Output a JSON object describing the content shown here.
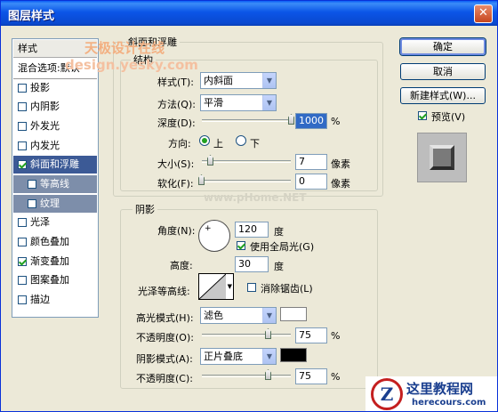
{
  "window": {
    "title": "图层样式",
    "close_glyph": "✕"
  },
  "left_list": {
    "items": [
      {
        "label": "样式",
        "checkbox": false,
        "state": "header"
      },
      {
        "label": "混合选项:默认",
        "checkbox": false,
        "state": "normal"
      },
      {
        "label": "投影",
        "checkbox": true,
        "checked": false,
        "state": "normal"
      },
      {
        "label": "内阴影",
        "checkbox": true,
        "checked": false,
        "state": "normal"
      },
      {
        "label": "外发光",
        "checkbox": true,
        "checked": false,
        "state": "normal"
      },
      {
        "label": "内发光",
        "checkbox": true,
        "checked": false,
        "state": "normal"
      },
      {
        "label": "斜面和浮雕",
        "checkbox": true,
        "checked": true,
        "state": "selected"
      },
      {
        "label": "等高线",
        "checkbox": true,
        "checked": false,
        "state": "sub"
      },
      {
        "label": "纹理",
        "checkbox": true,
        "checked": false,
        "state": "sub"
      },
      {
        "label": "光泽",
        "checkbox": true,
        "checked": false,
        "state": "normal"
      },
      {
        "label": "颜色叠加",
        "checkbox": true,
        "checked": false,
        "state": "normal"
      },
      {
        "label": "渐变叠加",
        "checkbox": true,
        "checked": true,
        "state": "normal"
      },
      {
        "label": "图案叠加",
        "checkbox": true,
        "checked": false,
        "state": "normal"
      },
      {
        "label": "描边",
        "checkbox": true,
        "checked": false,
        "state": "normal"
      }
    ]
  },
  "bevel": {
    "group_title": "斜面和浮雕",
    "structure_title": "结构",
    "style_label": "样式(T):",
    "style_value": "内斜面",
    "technique_label": "方法(Q):",
    "technique_value": "平滑",
    "depth_label": "深度(D):",
    "depth_value": "1000",
    "depth_unit": "%",
    "depth_level": 1.0,
    "direction_label": "方向:",
    "direction_up": "上",
    "direction_down": "下",
    "direction_selected": "上",
    "size_label": "大小(S):",
    "size_value": "7",
    "size_unit": "像素",
    "size_level": 0.05,
    "soften_label": "软化(F):",
    "soften_value": "0",
    "soften_unit": "像素",
    "soften_level": 0.0
  },
  "shading": {
    "group_title": "阴影",
    "angle_label": "角度(N):",
    "angle_value": "120",
    "angle_unit": "度",
    "global_light_label": "使用全局光(G)",
    "global_light_checked": true,
    "altitude_label": "高度:",
    "altitude_value": "30",
    "altitude_unit": "度",
    "gloss_label": "光泽等高线:",
    "antialias_label": "消除锯齿(L)",
    "antialias_checked": false,
    "highlight_mode_label": "高光模式(H):",
    "highlight_mode_value": "滤色",
    "highlight_color": "#ffffff",
    "highlight_opacity_label": "不透明度(O):",
    "highlight_opacity_value": "75",
    "highlight_opacity_unit": "%",
    "highlight_opacity_level": 0.75,
    "shadow_mode_label": "阴影模式(A):",
    "shadow_mode_value": "正片叠底",
    "shadow_color": "#000000",
    "shadow_opacity_label": "不透明度(C):",
    "shadow_opacity_value": "75",
    "shadow_opacity_unit": "%",
    "shadow_opacity_level": 0.75
  },
  "buttons": {
    "ok": "确定",
    "cancel": "取消",
    "new_style": "新建样式(W)...",
    "preview_label": "预览(V)",
    "preview_checked": true
  },
  "watermarks": {
    "top_cn": "天极设计在线",
    "top_url": "design.yesky.com",
    "mid": "www.pHome.NET",
    "bottom_brand": "这里教程网",
    "bottom_url": "herecours.com"
  },
  "colors": {
    "title_bar": "#0a49d0",
    "selected": "#3c5a96",
    "sub_item": "#7d8eaa",
    "dialog_bg": "#ece9d8"
  }
}
